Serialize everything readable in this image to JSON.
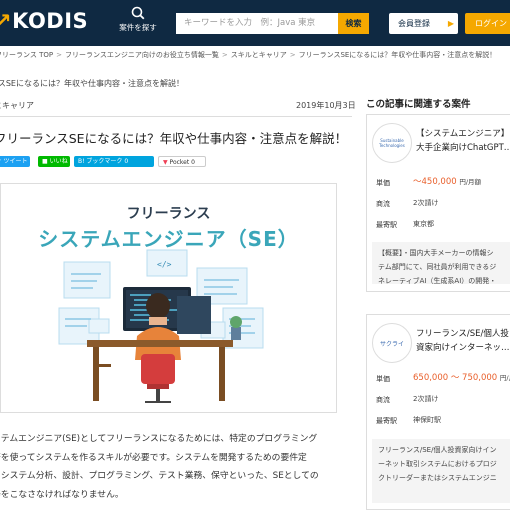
{
  "header": {
    "logo_main": "KODIS",
    "logo_prefix": "↗",
    "search_label": "案件を探す",
    "search_placeholder": "キーワードを入力　例：Java 東京",
    "search_button": "検索",
    "register_button": "会員登録",
    "login_button": "ログイン"
  },
  "breadcrumb": [
    "フリーランス TOP",
    "フリーランスエンジニア向けのお役立ち情報一覧",
    "スキルとキャリア",
    "フリーランスSEになるには？年収や仕事内容・注意点を解説！"
  ],
  "breadcrumb_prefix": "ズ",
  "subtitle_line": "ランスSEになるには？年収や仕事内容・注意点を解説！",
  "article": {
    "category": "とキャリア",
    "date": "2019年10月3日",
    "title": "フリーランスSEになるには？年収や仕事内容・注意点を解説！",
    "share": {
      "tweet": "ツイート",
      "line": "いいね",
      "hatena": "B! ブックマーク",
      "hatena_count": "0",
      "pocket": "Pocket",
      "pocket_count": "0"
    },
    "hero": {
      "subtitle": "フリーランス",
      "title": "システムエンジニア（SE）"
    },
    "body": [
      "ステムエンジニア(SE)としてフリーランスになるためには、特定のプログラミング",
      "語を使ってシステムを作るスキルが必要です。システムを開発するための要件定",
      "、システム分析、設計、プログラミング、テスト業務、保守といった、SEとしての",
      "務をこなさなければなりません。"
    ]
  },
  "sidebar": {
    "heading": "この記事に関連する案件",
    "jobs": [
      {
        "logo_text": "Sustainable Technologies",
        "title_line1": "【システムエンジニア】",
        "title_line2": "大手企業向けChatGPT…",
        "rows": [
          {
            "key": "単価",
            "value": "～450,000",
            "unit": "円/月額"
          },
          {
            "key": "商流",
            "value": "2次請け"
          },
          {
            "key": "最寄駅",
            "value": "東京都"
          }
        ],
        "desc": [
          "【概要】・国内大手メーカーの情報シ",
          "テム部門にて、同社員が利用できるジ",
          "ネレーティブAI（生成系AI）の開発・"
        ]
      },
      {
        "logo_text": "サクライ",
        "title_line1": "フリーランス/SE/個人投",
        "title_line2": "資家向けインターネッ…",
        "rows": [
          {
            "key": "単価",
            "value": "650,000 ～ 750,000",
            "unit": "円/月"
          },
          {
            "key": "商流",
            "value": "2次請け"
          },
          {
            "key": "最寄駅",
            "value": "神保町駅"
          }
        ],
        "desc": [
          "フリーランス/SE/個人投資家向けイン",
          "ーネット取引システムにおけるプロジ",
          "クトリーダーまたはシステムエンジニ"
        ]
      }
    ]
  },
  "colors": {
    "header_bg": "#0f2942",
    "accent": "#f5a800",
    "price": "#e95f2b",
    "hero_title": "#3aa6b9"
  }
}
